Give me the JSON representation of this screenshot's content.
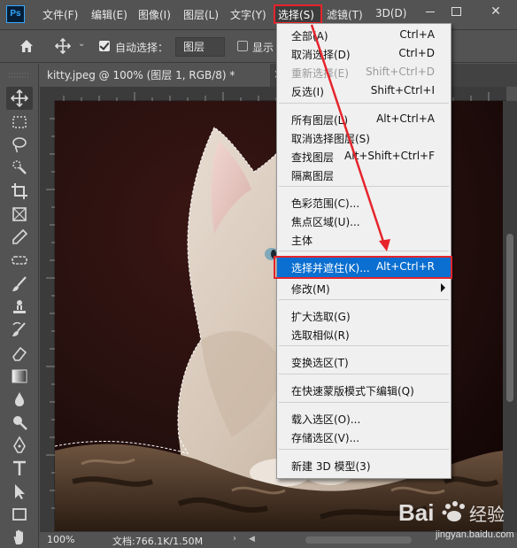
{
  "app": {
    "logo": "Ps"
  },
  "menubar": {
    "items": [
      {
        "label": "文件(F)"
      },
      {
        "label": "编辑(E)"
      },
      {
        "label": "图像(I)"
      },
      {
        "label": "图层(L)"
      },
      {
        "label": "文字(Y)"
      },
      {
        "label": "选择(S)",
        "active": true
      },
      {
        "label": "滤镜(T)"
      },
      {
        "label": "3D(D)"
      }
    ],
    "window_controls": {
      "close_glyph": "✕"
    }
  },
  "options": {
    "auto_select_label": "自动选择：",
    "auto_select_checked": true,
    "layer_select_value": "图层",
    "show_label": "显示",
    "dropdown_glyph": "⌄"
  },
  "document": {
    "tab_title": "kitty.jpeg @ 100% (图层 1, RGB/8) *",
    "close_glyph": "×"
  },
  "status": {
    "zoom": "100%",
    "doc_size": "文档:766.1K/1.50M",
    "arrow_glyph": "›",
    "scroll_left_glyph": "◀"
  },
  "watermark": {
    "brand": "Bai",
    "brand_tail": "经验",
    "sub": "jingyan.baidu.com"
  },
  "select_menu": {
    "items": [
      {
        "label": "全部(A)",
        "shortcut": "Ctrl+A"
      },
      {
        "label": "取消选择(D)",
        "shortcut": "Ctrl+D"
      },
      {
        "label": "重新选择(E)",
        "shortcut": "Shift+Ctrl+D",
        "disabled": true
      },
      {
        "label": "反选(I)",
        "shortcut": "Shift+Ctrl+I"
      },
      {
        "label": "所有图层(L)",
        "shortcut": "Alt+Ctrl+A"
      },
      {
        "label": "取消选择图层(S)",
        "shortcut": ""
      },
      {
        "label": "查找图层",
        "shortcut": "Alt+Shift+Ctrl+F"
      },
      {
        "label": "隔离图层",
        "shortcut": ""
      },
      {
        "label": "色彩范围(C)...",
        "shortcut": ""
      },
      {
        "label": "焦点区域(U)...",
        "shortcut": ""
      },
      {
        "label": "主体",
        "shortcut": ""
      },
      {
        "label": "选择并遮住(K)...",
        "shortcut": "Alt+Ctrl+R",
        "highlighted": true
      },
      {
        "label": "修改(M)",
        "shortcut": "",
        "submenu": true
      },
      {
        "label": "扩大选取(G)",
        "shortcut": ""
      },
      {
        "label": "选取相似(R)",
        "shortcut": ""
      },
      {
        "label": "变换选区(T)",
        "shortcut": ""
      },
      {
        "label": "在快速蒙版模式下编辑(Q)",
        "shortcut": ""
      },
      {
        "label": "载入选区(O)...",
        "shortcut": ""
      },
      {
        "label": "存储选区(V)...",
        "shortcut": ""
      },
      {
        "label": "新建 3D 模型(3)",
        "shortcut": ""
      }
    ]
  },
  "colors": {
    "ui_bg": "#535353",
    "menu_bg": "#f0f0f0",
    "highlight": "#0a6fd0",
    "annotation_red": "#e6242c",
    "ps_blue": "#31a8ff"
  },
  "tools": [
    "move-icon",
    "marquee-icon",
    "lasso-icon",
    "quick-select-icon",
    "crop-icon",
    "frame-icon",
    "eyedropper-icon",
    "healing-icon",
    "brush-icon",
    "stamp-icon",
    "history-brush-icon",
    "eraser-icon",
    "gradient-icon",
    "blur-icon",
    "dodge-icon",
    "pen-icon",
    "type-icon",
    "path-select-icon",
    "rectangle-icon",
    "hand-icon"
  ]
}
